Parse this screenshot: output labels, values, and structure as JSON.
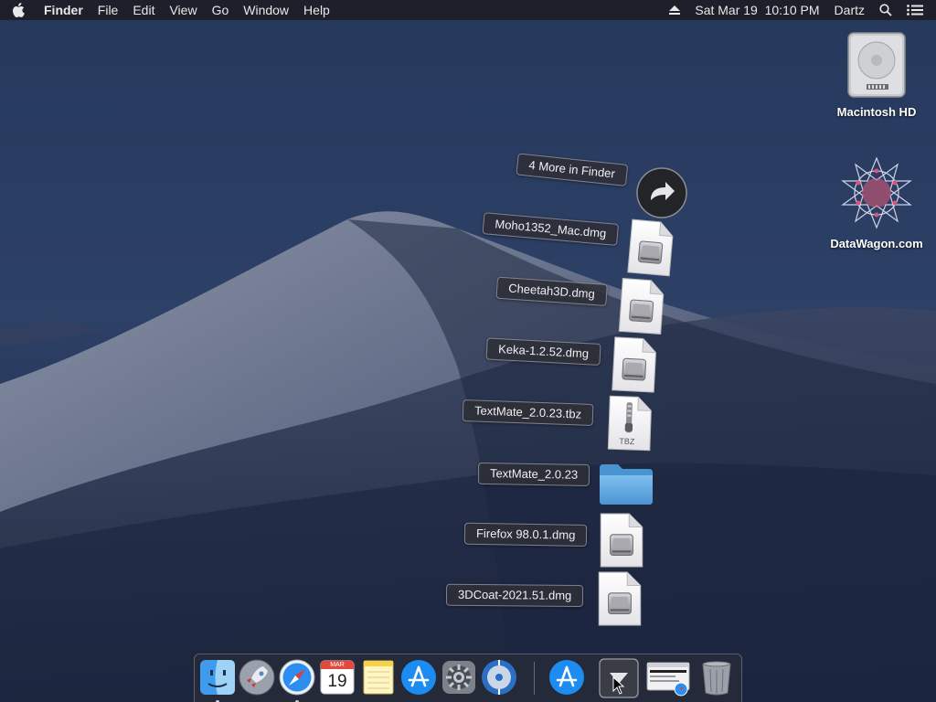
{
  "menubar": {
    "apple_icon": "apple-icon",
    "app_name": "Finder",
    "menus": [
      "File",
      "Edit",
      "View",
      "Go",
      "Window",
      "Help"
    ],
    "status": {
      "eject_icon": "eject-icon",
      "datetime": "Sat Mar 19  10:10 PM",
      "user": "Dartz",
      "search_icon": "spotlight-search-icon",
      "notification_icon": "notification-center-icon"
    }
  },
  "desktop_icons": [
    {
      "label": "Macintosh HD",
      "icon": "hard-drive-icon"
    },
    {
      "label": "DataWagon.com",
      "icon": "datawagon-logo-icon"
    }
  ],
  "stack": {
    "more_label": "4 More in Finder",
    "more_icon": "arrow-forward-icon",
    "items": [
      {
        "label": "Moho1352_Mac.dmg",
        "icon": "dmg-file-icon"
      },
      {
        "label": "Cheetah3D.dmg",
        "icon": "dmg-file-icon"
      },
      {
        "label": "Keka-1.2.52.dmg",
        "icon": "dmg-file-icon"
      },
      {
        "label": "TextMate_2.0.23.tbz",
        "icon": "tbz-archive-icon",
        "badge": "TBZ"
      },
      {
        "label": "TextMate_2.0.23",
        "icon": "folder-icon"
      },
      {
        "label": "Firefox 98.0.1.dmg",
        "icon": "dmg-file-icon"
      },
      {
        "label": "3DCoat-2021.51.dmg",
        "icon": "dmg-file-icon"
      }
    ]
  },
  "dock": {
    "items": [
      {
        "name": "finder",
        "icon": "finder-icon",
        "running": true
      },
      {
        "name": "launchpad",
        "icon": "launchpad-rocket-icon",
        "running": false
      },
      {
        "name": "safari",
        "icon": "safari-compass-icon",
        "running": true
      },
      {
        "name": "calendar",
        "icon": "calendar-icon",
        "running": false,
        "month": "MAR",
        "day": "19"
      },
      {
        "name": "notes",
        "icon": "notes-icon",
        "running": false
      },
      {
        "name": "app-store",
        "icon": "app-store-icon",
        "running": false
      },
      {
        "name": "system-preferences",
        "icon": "gear-icon",
        "running": false
      },
      {
        "name": "quicktime",
        "icon": "disc-utility-icon",
        "running": false
      },
      {
        "name": "downloads-appstore",
        "icon": "app-store-folder-icon",
        "running": false
      },
      {
        "name": "downloads-stack",
        "icon": "downloads-stack-icon",
        "running": false
      },
      {
        "name": "web-preview",
        "icon": "safari-window-icon",
        "running": false
      },
      {
        "name": "trash",
        "icon": "trash-icon",
        "running": false
      }
    ]
  },
  "colors": {
    "menubar_bg": "#1c1e26",
    "label_bg": "#2d2f37",
    "folder_blue": "#5aa3dc",
    "appstore_blue": "#1d8cf0"
  }
}
